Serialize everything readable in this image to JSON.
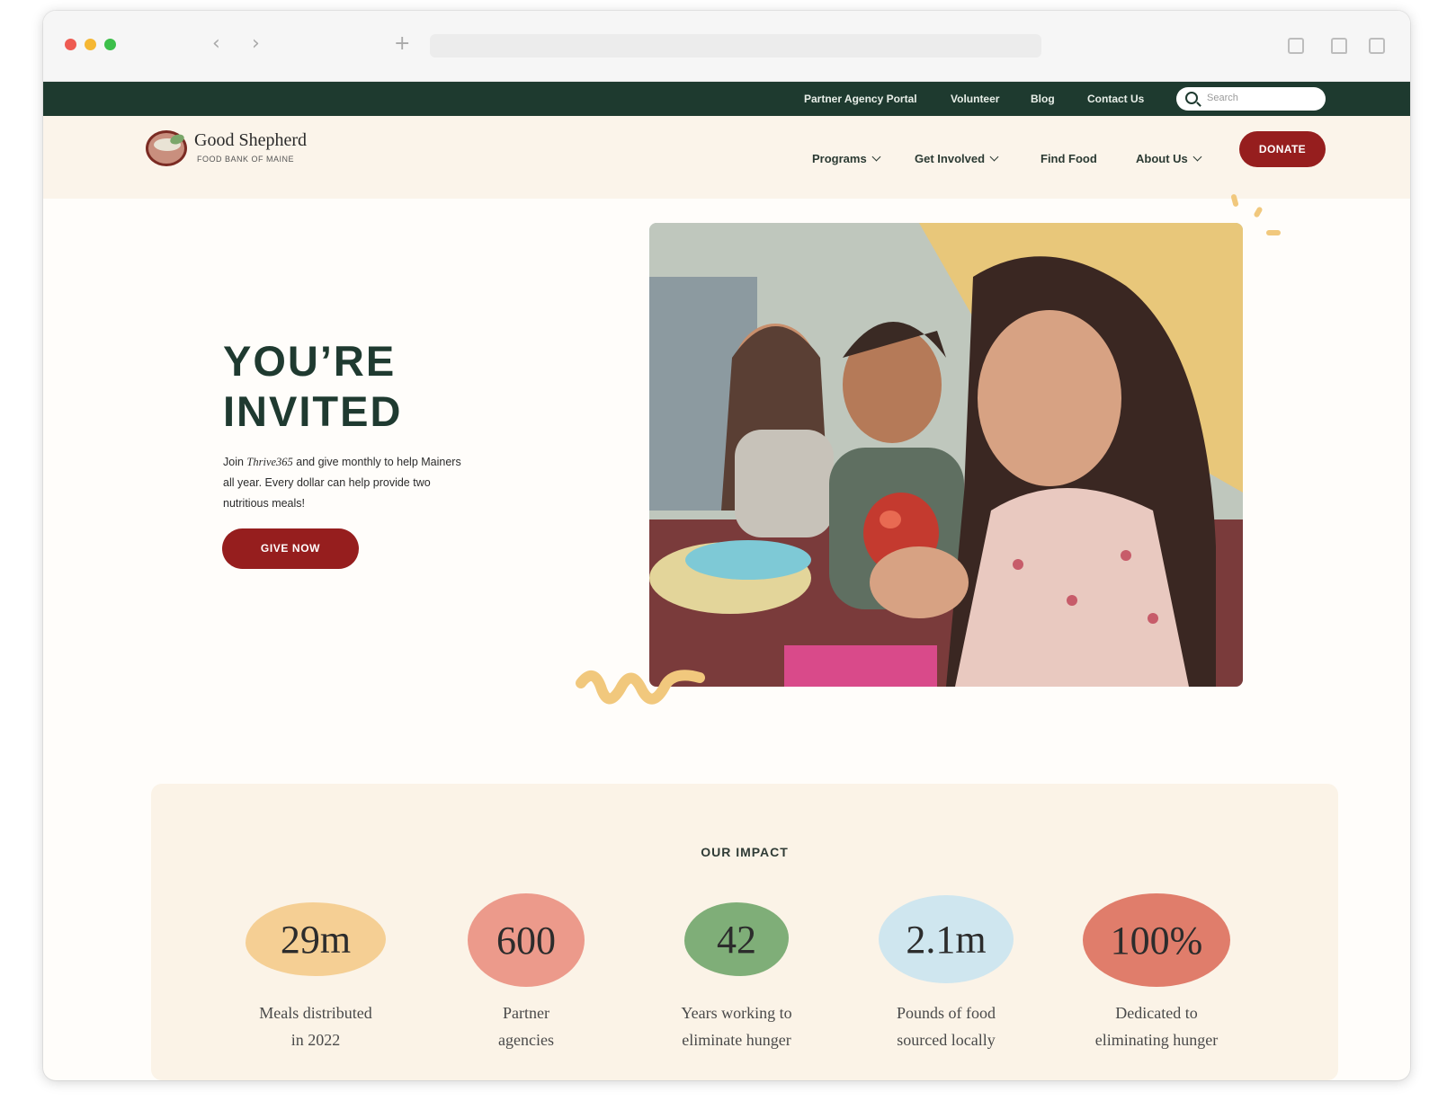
{
  "utility_nav": {
    "links": [
      "Partner Agency Portal",
      "Volunteer",
      "Blog",
      "Contact Us"
    ],
    "search_placeholder": "Search"
  },
  "brand": {
    "name": "Good Shepherd",
    "subtitle": "FOOD BANK OF MAINE"
  },
  "main_nav": {
    "items": [
      "Programs",
      "Get Involved",
      "Find Food",
      "About Us"
    ],
    "donate_label": "DONATE"
  },
  "hero": {
    "title_line1": "YOU’RE",
    "title_line2": "INVITED",
    "text_before": "Join ",
    "text_em": "Thrive365",
    "text_after": " and give monthly to help Mainers all year. Every dollar can help provide two nutritious meals!",
    "cta_label": "GIVE NOW"
  },
  "impact": {
    "title": "OUR IMPACT",
    "stats": [
      {
        "value": "29m",
        "label_line1": "Meals distributed",
        "label_line2": "in 2022",
        "color": "#f5cf94"
      },
      {
        "value": "600",
        "label_line1": "Partner",
        "label_line2": "agencies",
        "color": "#ec9a8b"
      },
      {
        "value": "42",
        "label_line1": "Years working to",
        "label_line2": "eliminate hunger",
        "color": "#7fae78"
      },
      {
        "value": "2.1m",
        "label_line1": "Pounds of food",
        "label_line2": "sourced locally",
        "color": "#cfe6ef"
      },
      {
        "value": "100%",
        "label_line1": "Dedicated to",
        "label_line2": "eliminating hunger",
        "color": "#e07d6b"
      }
    ]
  },
  "colors": {
    "dark_green": "#1e3a2f",
    "brand_red": "#961e1e",
    "cream": "#fbf4ea"
  }
}
